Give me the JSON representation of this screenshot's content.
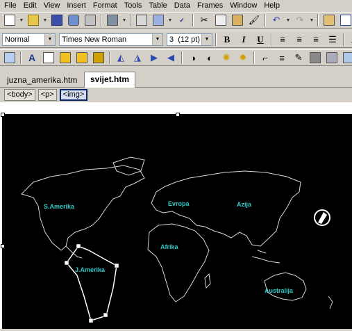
{
  "menu": [
    "File",
    "Edit",
    "View",
    "Insert",
    "Format",
    "Tools",
    "Table",
    "Data",
    "Frames",
    "Window",
    "Help"
  ],
  "format_bar": {
    "style": "Normal",
    "font": "Times New Roman",
    "size": "3  (12 pt)",
    "bold": "B",
    "italic": "I",
    "underline": "U"
  },
  "tabs": [
    "juzna_amerika.htm",
    "svijet.htm"
  ],
  "tag_selector": [
    "<body>",
    "<p>",
    "<img>"
  ],
  "map_labels": {
    "north_america": "S.Amerika",
    "europe": "Evropa",
    "asia": "Azija",
    "africa": "Afrika",
    "south_america": "J.Amerika",
    "australia": "Australija"
  }
}
